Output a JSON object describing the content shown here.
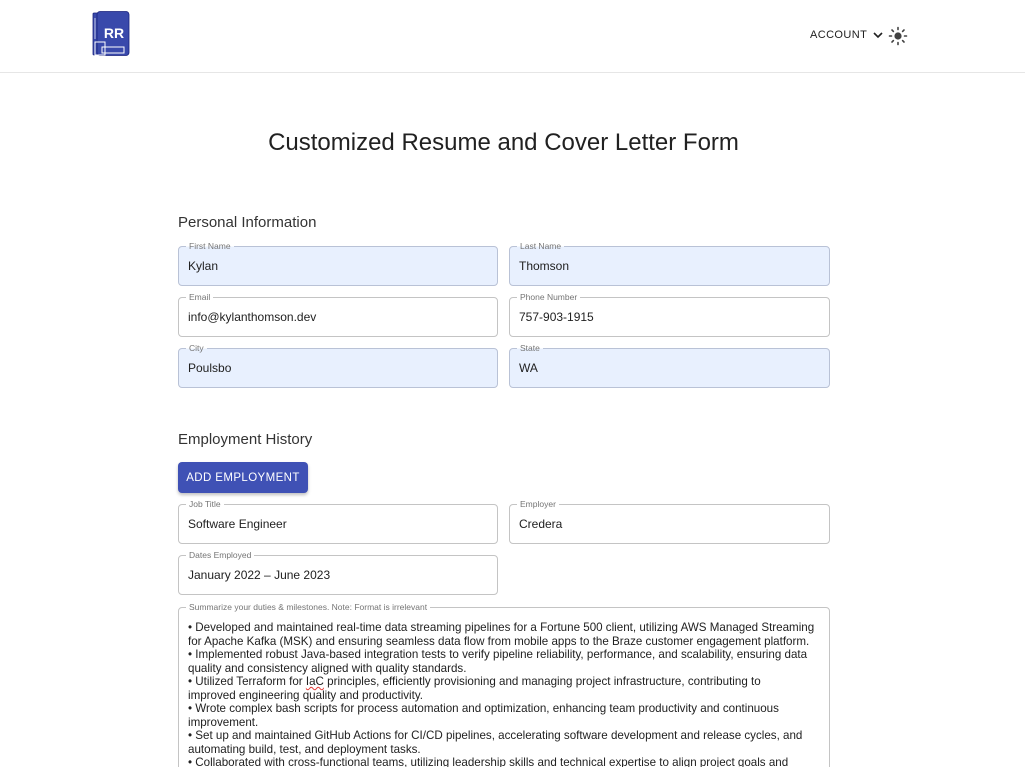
{
  "header": {
    "logo_text": "RR",
    "account_label": "ACCOUNT"
  },
  "page": {
    "title": "Customized Resume and Cover Letter Form"
  },
  "personal": {
    "section_title": "Personal Information",
    "first_name": {
      "label": "First Name",
      "value": "Kylan"
    },
    "last_name": {
      "label": "Last Name",
      "value": "Thomson"
    },
    "email": {
      "label": "Email",
      "value": "info@kylanthomson.dev"
    },
    "phone": {
      "label": "Phone Number",
      "value": "757-903-1915"
    },
    "city": {
      "label": "City",
      "value": "Poulsbo"
    },
    "state": {
      "label": "State",
      "value": "WA"
    }
  },
  "employment": {
    "section_title": "Employment History",
    "add_button": "ADD EMPLOYMENT",
    "job_title": {
      "label": "Job Title",
      "value": "Software Engineer"
    },
    "employer": {
      "label": "Employer",
      "value": "Credera"
    },
    "dates": {
      "label": "Dates Employed",
      "value": "January 2022 – June 2023"
    },
    "summary": {
      "label": "Summarize your duties & milestones. Note: Format is irrelevant",
      "lines": [
        "• Developed and maintained real-time data streaming pipelines for a Fortune 500 client, utilizing AWS Managed Streaming",
        "for Apache Kafka (MSK) and ensuring seamless data flow from mobile apps to the Braze customer engagement platform.",
        "• Implemented robust Java-based integration tests to verify pipeline reliability, performance, and scalability, ensuring data",
        "quality and consistency aligned with quality standards.",
        "• Utilized Terraform for ",
        "improved engineering quality and productivity.",
        "• Wrote complex bash scripts for process automation and optimization, enhancing team productivity and continuous",
        "improvement.",
        "• Set up and maintained GitHub Actions for CI/CD pipelines, accelerating software development and release cycles, and",
        "automating build, test, and deployment tasks.",
        "• Collaborated with cross-functional teams, utilizing leadership skills and technical expertise to align project goals and"
      ],
      "squiggle_word": "IaC",
      "line5_rest": " principles, efficiently provisioning and managing project infrastructure, contributing to"
    }
  },
  "colors": {
    "primary": "#3f51b5",
    "autofill_bg": "#e8f0fe",
    "logo": "#3949ab"
  },
  "icons": {
    "logo": "resume-logo-icon",
    "account_caret": "chevron-down-icon",
    "theme": "sun-icon"
  }
}
